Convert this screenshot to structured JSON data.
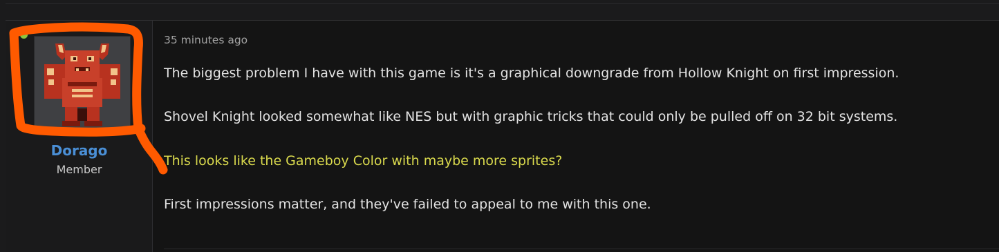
{
  "post": {
    "user": {
      "name": "Dorago",
      "title": "Member",
      "online": true,
      "online_color": "#8cc63f",
      "name_color": "#4a8fd6"
    },
    "date": "35 minutes ago",
    "paragraphs": [
      "The biggest problem I have with this game is it's a graphical downgrade from Hollow Knight on first impression.",
      "Shovel Knight looked somewhat like NES but with graphic tricks that could only be pulled off on 32 bit systems.",
      "This looks like the Gameboy Color with maybe more sprites?",
      "First impressions matter, and they've failed to appeal to me with this one."
    ],
    "highlight_color": "#dada4d",
    "annotation_color": "#ff5a00"
  }
}
